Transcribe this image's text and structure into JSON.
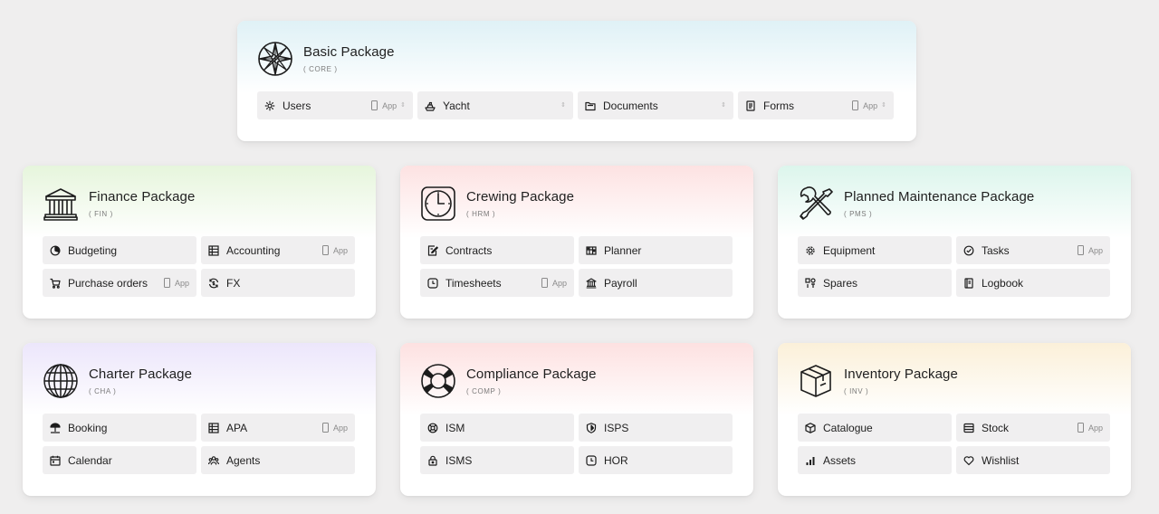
{
  "accent_colors": {
    "core": "#dff1f6",
    "fin": "#e6f5dc",
    "hrm": "#fde2e2",
    "pms": "#dcf5ec",
    "cha": "#ece6fb",
    "comp": "#fde1e1",
    "inv": "#fbf0d9"
  },
  "packages": {
    "core": {
      "title": "Basic Package",
      "code": "( CORE )",
      "icon": "compass-rose-icon",
      "items": [
        {
          "label": "Users",
          "icon": "gear-icon",
          "app": "App"
        },
        {
          "label": "Yacht",
          "icon": "yacht-icon"
        },
        {
          "label": "Documents",
          "icon": "folder-icon"
        },
        {
          "label": "Forms",
          "icon": "form-icon",
          "app": "App"
        }
      ]
    },
    "fin": {
      "title": "Finance Package",
      "code": "( FIN )",
      "icon": "bank-icon",
      "items": [
        {
          "label": "Budgeting",
          "icon": "pie-chart-icon"
        },
        {
          "label": "Accounting",
          "icon": "grid-icon",
          "app": "App"
        },
        {
          "label": "Purchase orders",
          "icon": "cart-icon",
          "app": "App"
        },
        {
          "label": "FX",
          "icon": "currency-exchange-icon"
        }
      ]
    },
    "hrm": {
      "title": "Crewing Package",
      "code": "( HRM )",
      "icon": "clock-icon",
      "items": [
        {
          "label": "Contracts",
          "icon": "contract-icon"
        },
        {
          "label": "Planner",
          "icon": "planner-icon"
        },
        {
          "label": "Timesheets",
          "icon": "timer-icon",
          "app": "App"
        },
        {
          "label": "Payroll",
          "icon": "bank-icon"
        }
      ]
    },
    "pms": {
      "title": "Planned Maintenance Package",
      "code": "( PMS )",
      "icon": "tools-icon",
      "items": [
        {
          "label": "Equipment",
          "icon": "gear-icon"
        },
        {
          "label": "Tasks",
          "icon": "check-circle-icon",
          "app": "App"
        },
        {
          "label": "Spares",
          "icon": "spares-icon"
        },
        {
          "label": "Logbook",
          "icon": "book-icon"
        }
      ]
    },
    "cha": {
      "title": "Charter Package",
      "code": "( CHA )",
      "icon": "globe-icon",
      "items": [
        {
          "label": "Booking",
          "icon": "beach-icon"
        },
        {
          "label": "APA",
          "icon": "grid-icon",
          "app": "App"
        },
        {
          "label": "Calendar",
          "icon": "calendar-icon"
        },
        {
          "label": "Agents",
          "icon": "people-icon"
        }
      ]
    },
    "comp": {
      "title": "Compliance Package",
      "code": "( COMP )",
      "icon": "lifebuoy-icon",
      "items": [
        {
          "label": "ISM",
          "icon": "lifebuoy-small-icon"
        },
        {
          "label": "ISPS",
          "icon": "shield-icon"
        },
        {
          "label": "ISMS",
          "icon": "lock-icon"
        },
        {
          "label": "HOR",
          "icon": "timer-icon"
        }
      ]
    },
    "inv": {
      "title": "Inventory Package",
      "code": "( INV )",
      "icon": "box-icon",
      "items": [
        {
          "label": "Catalogue",
          "icon": "box-small-icon"
        },
        {
          "label": "Stock",
          "icon": "stack-icon",
          "app": "App"
        },
        {
          "label": "Assets",
          "icon": "bar-chart-icon"
        },
        {
          "label": "Wishlist",
          "icon": "heart-icon"
        }
      ]
    }
  }
}
